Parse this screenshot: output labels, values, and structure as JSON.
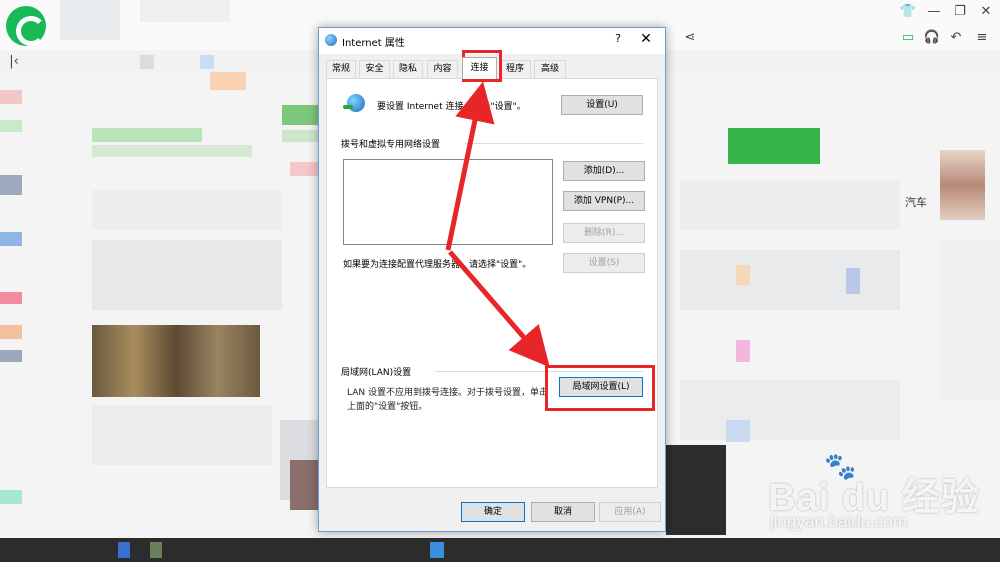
{
  "dialog": {
    "title": "Internet 属性",
    "help_glyph": "?",
    "close_glyph": "✕",
    "tabs": [
      {
        "label": "常规",
        "active": false
      },
      {
        "label": "安全",
        "active": false
      },
      {
        "label": "隐私",
        "active": false
      },
      {
        "label": "内容",
        "active": false
      },
      {
        "label": "连接",
        "active": true
      },
      {
        "label": "程序",
        "active": false
      },
      {
        "label": "高级",
        "active": false
      }
    ],
    "setup": {
      "text": "要设置 Internet 连接，单击\"设置\"。",
      "button": "设置(U)"
    },
    "dialup": {
      "heading": "拨号和虚拟专用网络设置",
      "add_button": "添加(D)...",
      "add_vpn_button": "添加 VPN(P)...",
      "remove_button": "删除(R)...",
      "settings_button": "设置(S)",
      "proxy_hint": "如果要为连接配置代理服务器，请选择\"设置\"。"
    },
    "lan": {
      "heading": "局域网(LAN)设置",
      "description_line1": "LAN 设置不应用到拨号连接。对于拨号设置，单击",
      "description_line2": "上面的\"设置\"按钮。",
      "button": "局域网设置(L)"
    },
    "footer": {
      "ok": "确定",
      "cancel": "取消",
      "apply": "应用(A)"
    }
  },
  "background": {
    "side_label": "汽车",
    "watermark_logo": "Bai du 经验",
    "watermark_url": "jingyan.baidu.com"
  },
  "colors": {
    "highlight": "#e8262a",
    "dialog_border": "#6f9ad6",
    "browser_brand": "#19b955"
  },
  "icons": [
    "browser-logo-icon",
    "globe-connection-icon",
    "internet-options-icon",
    "help-icon",
    "close-icon"
  ]
}
